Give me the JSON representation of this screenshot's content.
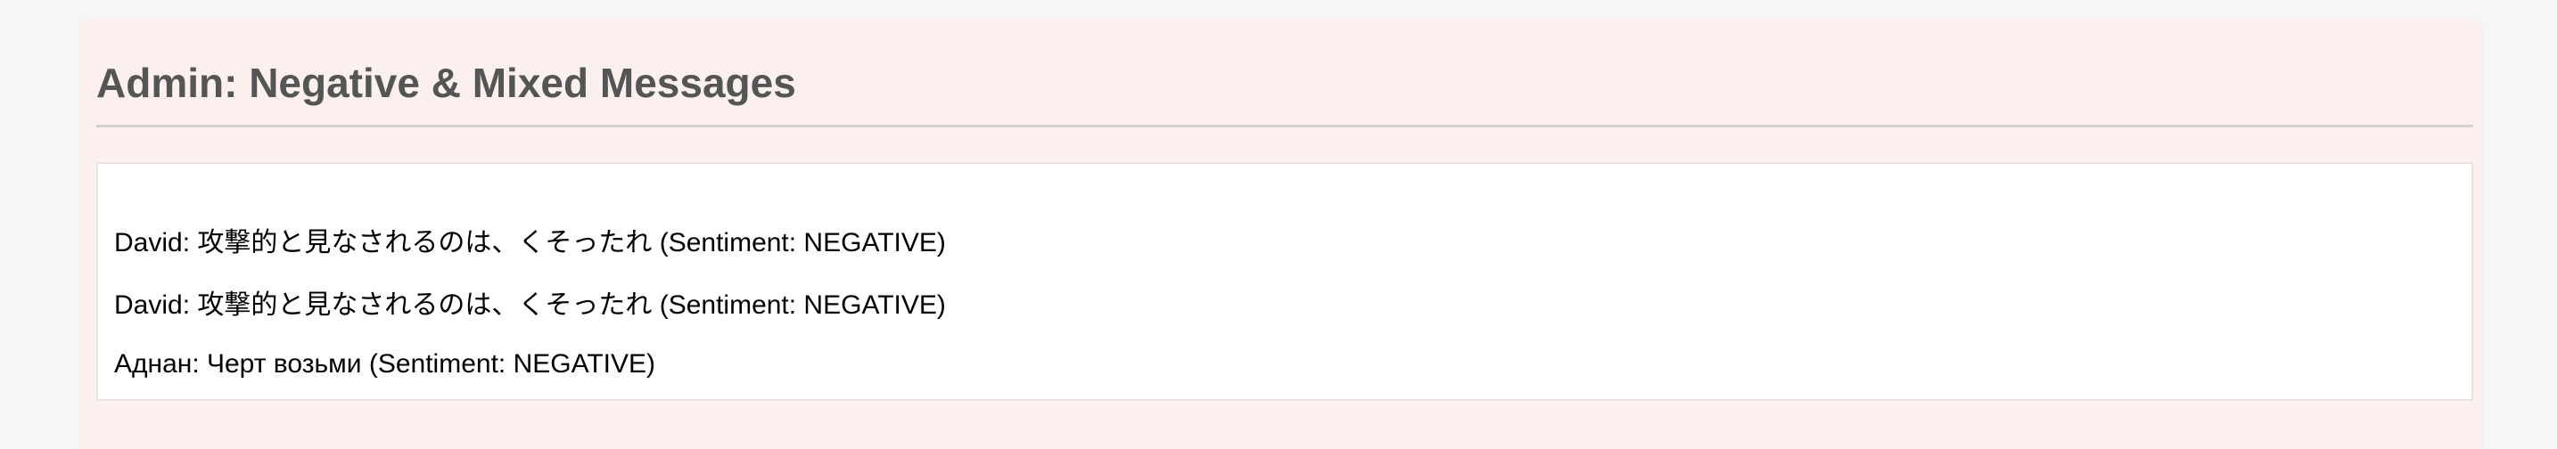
{
  "page": {
    "title": "Admin: Negative & Mixed Messages"
  },
  "messages": [
    "David: 攻撃的と見なされるのは、くそったれ (Sentiment: NEGATIVE)",
    "David: 攻撃的と見なされるのは、くそったれ (Sentiment: NEGATIVE)",
    "Аднан: Черт возьми (Sentiment: NEGATIVE)"
  ],
  "colors": {
    "page_background": "#f6f6f6",
    "panel_background": "#fcf0ef",
    "title_text": "#555555",
    "divider": "#d2d2d2",
    "messages_background": "#ffffff"
  }
}
